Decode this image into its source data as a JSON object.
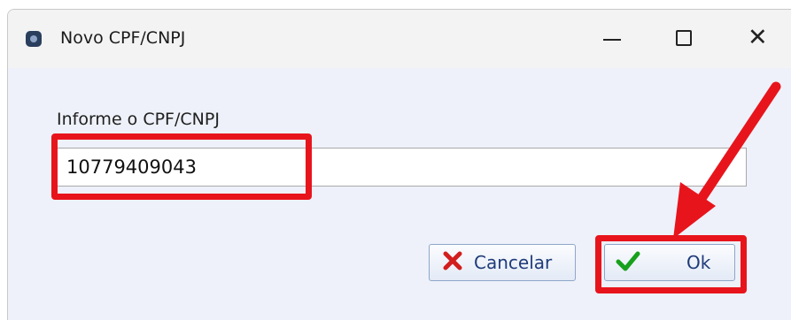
{
  "window": {
    "title": "Novo CPF/CNPJ",
    "icons": [
      "app-icon",
      "minimize-icon",
      "maximize-icon",
      "close-icon"
    ]
  },
  "form": {
    "label": "Informe o CPF/CNPJ",
    "value": "10779409043"
  },
  "buttons": {
    "cancel_label": "Cancelar",
    "ok_label": "Ok",
    "cancel_icon": "red-x-icon",
    "ok_icon": "green-check-icon"
  },
  "annotation": {
    "color": "#e8141c"
  }
}
